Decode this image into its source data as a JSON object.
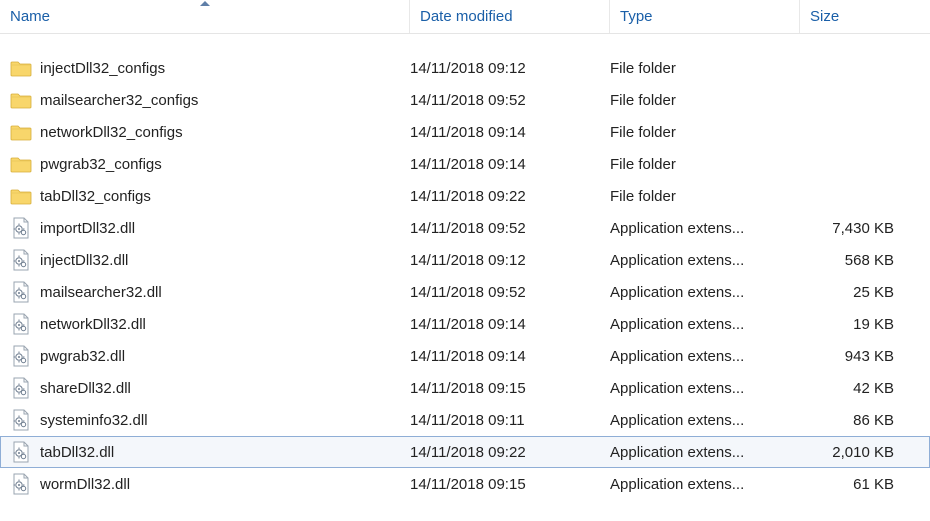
{
  "columns": {
    "name": "Name",
    "date": "Date modified",
    "type": "Type",
    "size": "Size"
  },
  "sort": {
    "column": "name",
    "direction": "asc"
  },
  "selected_index": 12,
  "items": [
    {
      "icon": "folder",
      "name": "injectDll32_configs",
      "date": "14/11/2018 09:12",
      "type": "File folder",
      "size": ""
    },
    {
      "icon": "folder",
      "name": "mailsearcher32_configs",
      "date": "14/11/2018 09:52",
      "type": "File folder",
      "size": ""
    },
    {
      "icon": "folder",
      "name": "networkDll32_configs",
      "date": "14/11/2018 09:14",
      "type": "File folder",
      "size": ""
    },
    {
      "icon": "folder",
      "name": "pwgrab32_configs",
      "date": "14/11/2018 09:14",
      "type": "File folder",
      "size": ""
    },
    {
      "icon": "folder",
      "name": "tabDll32_configs",
      "date": "14/11/2018 09:22",
      "type": "File folder",
      "size": ""
    },
    {
      "icon": "dll",
      "name": "importDll32.dll",
      "date": "14/11/2018 09:52",
      "type": "Application extens...",
      "size": "7,430 KB"
    },
    {
      "icon": "dll",
      "name": "injectDll32.dll",
      "date": "14/11/2018 09:12",
      "type": "Application extens...",
      "size": "568 KB"
    },
    {
      "icon": "dll",
      "name": "mailsearcher32.dll",
      "date": "14/11/2018 09:52",
      "type": "Application extens...",
      "size": "25 KB"
    },
    {
      "icon": "dll",
      "name": "networkDll32.dll",
      "date": "14/11/2018 09:14",
      "type": "Application extens...",
      "size": "19 KB"
    },
    {
      "icon": "dll",
      "name": "pwgrab32.dll",
      "date": "14/11/2018 09:14",
      "type": "Application extens...",
      "size": "943 KB"
    },
    {
      "icon": "dll",
      "name": "shareDll32.dll",
      "date": "14/11/2018 09:15",
      "type": "Application extens...",
      "size": "42 KB"
    },
    {
      "icon": "dll",
      "name": "systeminfo32.dll",
      "date": "14/11/2018 09:11",
      "type": "Application extens...",
      "size": "86 KB"
    },
    {
      "icon": "dll",
      "name": "tabDll32.dll",
      "date": "14/11/2018 09:22",
      "type": "Application extens...",
      "size": "2,010 KB"
    },
    {
      "icon": "dll",
      "name": "wormDll32.dll",
      "date": "14/11/2018 09:15",
      "type": "Application extens...",
      "size": "61 KB"
    }
  ]
}
